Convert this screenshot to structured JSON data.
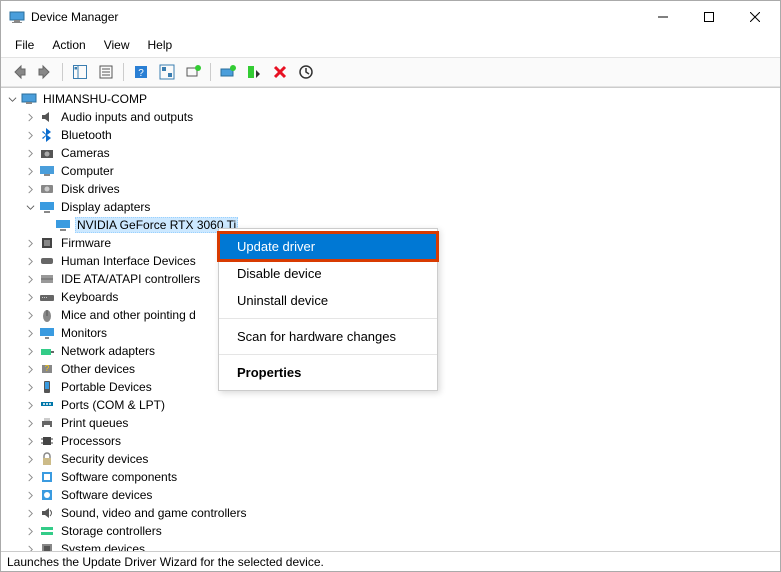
{
  "window": {
    "title": "Device Manager"
  },
  "menubar": {
    "file": "File",
    "action": "Action",
    "view": "View",
    "help": "Help"
  },
  "tree": {
    "root": "HIMANSHU-COMP",
    "items": {
      "audio": "Audio inputs and outputs",
      "bluetooth": "Bluetooth",
      "cameras": "Cameras",
      "computer": "Computer",
      "disk": "Disk drives",
      "display": "Display adapters",
      "display_child": "NVIDIA GeForce RTX 3060 Ti",
      "firmware": "Firmware",
      "hid": "Human Interface Devices",
      "ide": "IDE ATA/ATAPI controllers",
      "keyboards": "Keyboards",
      "mice": "Mice and other pointing d",
      "monitors": "Monitors",
      "network": "Network adapters",
      "other": "Other devices",
      "portable": "Portable Devices",
      "ports": "Ports (COM & LPT)",
      "print": "Print queues",
      "processors": "Processors",
      "security": "Security devices",
      "swcomp": "Software components",
      "swdev": "Software devices",
      "sound": "Sound, video and game controllers",
      "storage": "Storage controllers",
      "system": "System devices"
    }
  },
  "ctx": {
    "update": "Update driver",
    "disable": "Disable device",
    "uninstall": "Uninstall device",
    "scan": "Scan for hardware changes",
    "properties": "Properties"
  },
  "status": "Launches the Update Driver Wizard for the selected device."
}
